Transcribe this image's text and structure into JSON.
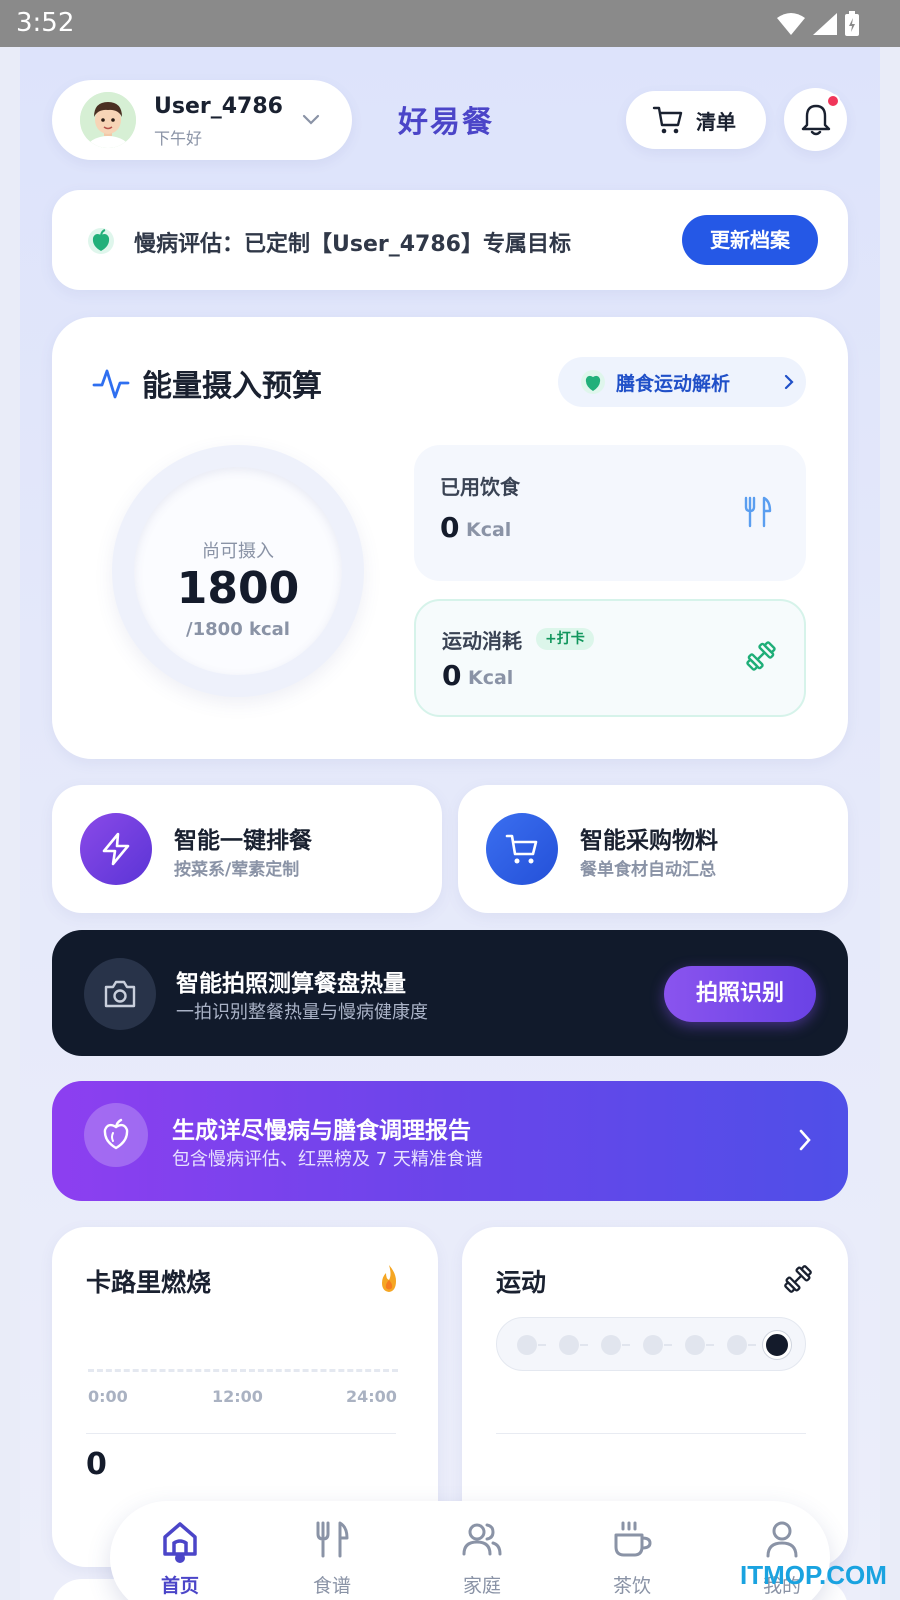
{
  "status_bar": {
    "time": "3:52"
  },
  "header": {
    "user_name": "User_4786",
    "greeting": "下午好",
    "app_title": "好易餐",
    "list_label": "清单"
  },
  "assessment": {
    "text": "慢病评估：已定制【User_4786】专属目标",
    "button": "更新档案"
  },
  "energy": {
    "title": "能量摄入预算",
    "analysis_link": "膳食运动解析",
    "ring_label": "尚可摄入",
    "ring_value": "1800",
    "ring_sub": "/1800 kcal",
    "food": {
      "label": "已用饮食",
      "value": "0",
      "unit": "Kcal"
    },
    "sport": {
      "label": "运动消耗",
      "badge": "+打卡",
      "value": "0",
      "unit": "Kcal"
    }
  },
  "quick_actions": [
    {
      "title": "智能一键排餐",
      "subtitle": "按菜系/荤素定制",
      "icon": "lightning-icon"
    },
    {
      "title": "智能采购物料",
      "subtitle": "餐单食材自动汇总",
      "icon": "cart-icon"
    }
  ],
  "photo_banner": {
    "title": "智能拍照测算餐盘热量",
    "subtitle": "一拍识别整餐热量与慢病健康度",
    "button": "拍照识别"
  },
  "report_banner": {
    "title": "生成详尽慢病与膳食调理报告",
    "subtitle": "包含慢病评估、红黑榜及 7 天精准食谱"
  },
  "calorie_card": {
    "title": "卡路里燃烧",
    "axis": [
      "0:00",
      "12:00",
      "24:00"
    ],
    "value": "0"
  },
  "sport_card": {
    "title": "运动",
    "steps_total": 7,
    "active_step": 7
  },
  "tabs": [
    {
      "label": "首页",
      "icon": "home-icon",
      "active": true
    },
    {
      "label": "食谱",
      "icon": "utensils-icon",
      "active": false
    },
    {
      "label": "家庭",
      "icon": "family-icon",
      "active": false
    },
    {
      "label": "茶饮",
      "icon": "cup-icon",
      "active": false
    },
    {
      "label": "我的",
      "icon": "profile-icon",
      "active": false
    }
  ],
  "watermark": "ITMOP.COM",
  "colors": {
    "accent": "#4b45c8",
    "primary_button": "#2558e6",
    "dark_banner": "#111a2b",
    "report_gradient_start": "#8d3ff0",
    "report_gradient_end": "#4f4fe8"
  }
}
